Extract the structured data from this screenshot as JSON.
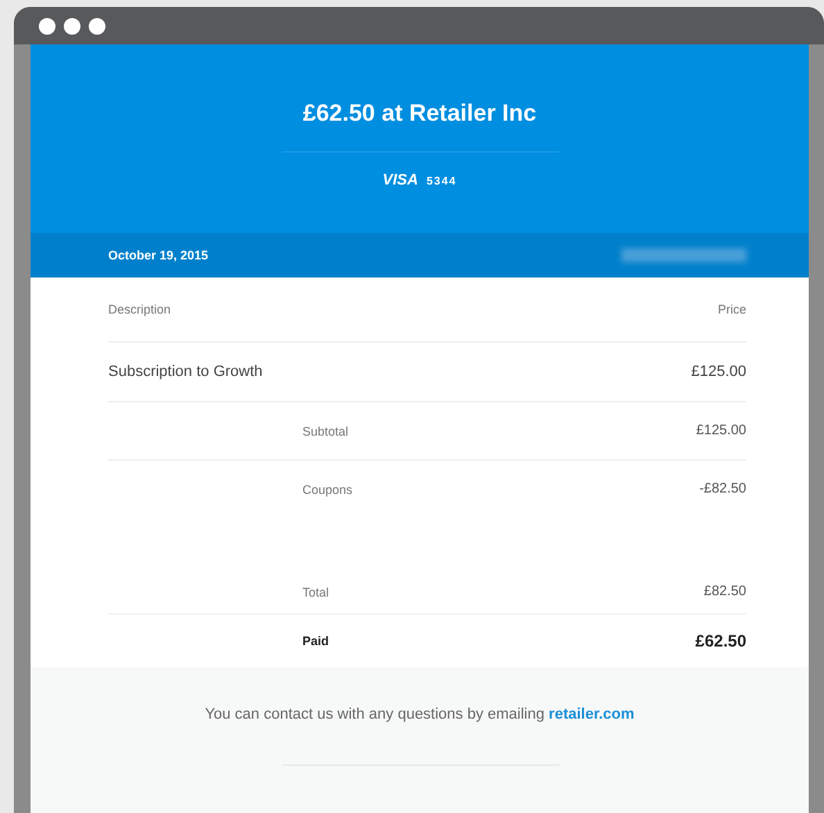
{
  "receipt": {
    "title": "£62.50 at Retailer Inc",
    "card_brand": "VISA",
    "card_last4": "5344",
    "date": "October 19, 2015"
  },
  "table": {
    "columns": [
      "Description",
      "Price"
    ],
    "rows": [
      {
        "description": "Subscription to Growth",
        "price": "£125.00"
      }
    ]
  },
  "summary": [
    {
      "label": "Subtotal",
      "amount": "£125.00",
      "kind": "plain"
    },
    {
      "label": "Coupons",
      "amount": "-£82.50",
      "kind": "plain"
    },
    {
      "label": "Total",
      "amount": "£82.50",
      "kind": "spaced"
    },
    {
      "label": "Paid",
      "amount": "£62.50",
      "kind": "strong"
    }
  ],
  "footer": {
    "text": "You can contact us with any questions by emailing",
    "link": "retailer.com"
  }
}
